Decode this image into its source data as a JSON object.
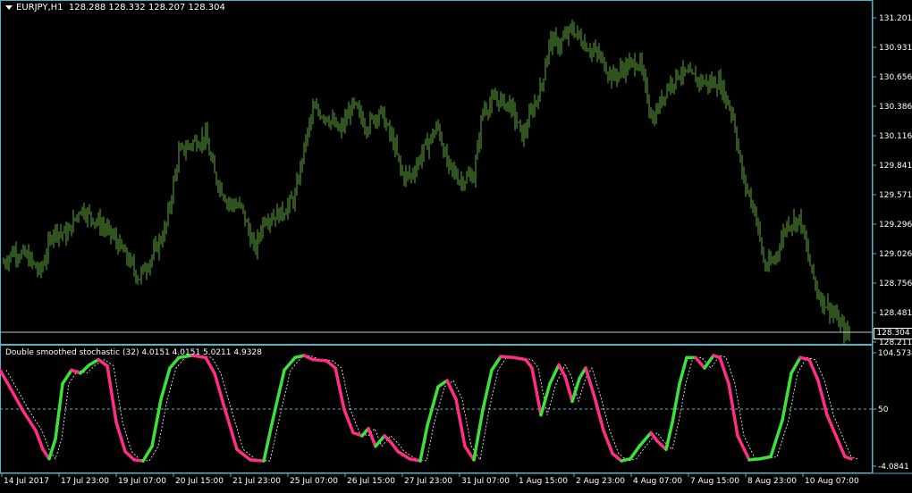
{
  "window": {
    "symbol_title": "EURJPY,H1",
    "ohlc": "128.288 128.332 128.207 128.304"
  },
  "indicator": {
    "title": "Double smoothed stochastic (32) 4.0151 4.0151 5.0211 4.9328"
  },
  "price_axis": {
    "labels": [
      "131.201",
      "130.931",
      "130.656",
      "130.386",
      "130.116",
      "129.841",
      "129.571",
      "129.296",
      "129.026",
      "128.756",
      "128.481",
      "128.211"
    ],
    "current_price": "128.304"
  },
  "indicator_axis": {
    "labels": [
      "104.5734",
      "50",
      "-4.0841"
    ],
    "levels": [
      0,
      50,
      100
    ]
  },
  "time_axis": {
    "labels": [
      "14 Jul 2017",
      "17 Jul 23:00",
      "19 Jul 07:00",
      "20 Jul 15:00",
      "21 Jul 23:00",
      "25 Jul 07:00",
      "26 Jul 15:00",
      "27 Jul 23:00",
      "31 Jul 07:00",
      "1 Aug 15:00",
      "2 Aug 23:00",
      "4 Aug 07:00",
      "7 Aug 15:00",
      "8 Aug 23:00",
      "10 Aug 07:00"
    ]
  },
  "colors": {
    "background": "#000000",
    "bars": "#5fa83c",
    "axis": "#4ab8c8",
    "stoch_up": "#3ee03a",
    "stoch_down": "#ff2d86",
    "signal": "#ffffff"
  },
  "chart_data": [
    {
      "type": "bar",
      "title": "EURJPY,H1",
      "ylim": [
        128.211,
        131.201
      ],
      "price_anchors": [
        [
          0,
          128.9
        ],
        [
          15,
          129.05
        ],
        [
          30,
          129.0
        ],
        [
          45,
          128.85
        ],
        [
          60,
          129.25
        ],
        [
          75,
          129.2
        ],
        [
          90,
          129.45
        ],
        [
          105,
          129.35
        ],
        [
          125,
          129.2
        ],
        [
          145,
          128.95
        ],
        [
          155,
          128.8
        ],
        [
          170,
          129.0
        ],
        [
          185,
          129.25
        ],
        [
          200,
          129.95
        ],
        [
          215,
          130.05
        ],
        [
          230,
          130.1
        ],
        [
          240,
          129.75
        ],
        [
          255,
          129.5
        ],
        [
          270,
          129.45
        ],
        [
          285,
          129.05
        ],
        [
          295,
          129.35
        ],
        [
          315,
          129.4
        ],
        [
          330,
          129.55
        ],
        [
          340,
          130.0
        ],
        [
          350,
          130.35
        ],
        [
          365,
          130.3
        ],
        [
          380,
          130.15
        ],
        [
          395,
          130.4
        ],
        [
          410,
          130.2
        ],
        [
          425,
          130.35
        ],
        [
          440,
          130.05
        ],
        [
          450,
          129.75
        ],
        [
          460,
          129.75
        ],
        [
          475,
          130.0
        ],
        [
          490,
          130.2
        ],
        [
          500,
          129.85
        ],
        [
          515,
          129.7
        ],
        [
          530,
          129.75
        ],
        [
          540,
          130.35
        ],
        [
          555,
          130.45
        ],
        [
          570,
          130.4
        ],
        [
          585,
          130.1
        ],
        [
          595,
          130.35
        ],
        [
          605,
          130.55
        ],
        [
          615,
          131.0
        ],
        [
          625,
          130.95
        ],
        [
          640,
          131.1
        ],
        [
          655,
          130.95
        ],
        [
          670,
          130.85
        ],
        [
          685,
          130.65
        ],
        [
          700,
          130.75
        ],
        [
          715,
          130.8
        ],
        [
          730,
          130.25
        ],
        [
          745,
          130.55
        ],
        [
          760,
          130.7
        ],
        [
          775,
          130.65
        ],
        [
          790,
          130.6
        ],
        [
          805,
          130.6
        ],
        [
          820,
          130.3
        ],
        [
          830,
          129.75
        ],
        [
          845,
          129.4
        ],
        [
          855,
          128.9
        ],
        [
          865,
          128.95
        ],
        [
          880,
          129.3
        ],
        [
          895,
          129.35
        ],
        [
          905,
          128.95
        ],
        [
          915,
          128.65
        ],
        [
          930,
          128.5
        ],
        [
          945,
          128.3
        ],
        [
          952,
          128.27
        ]
      ]
    },
    {
      "type": "line",
      "title": "Double smoothed stochastic (32)",
      "ylim": [
        -4.0841,
        104.5734
      ],
      "series": [
        {
          "name": "Double smoothed stochastic",
          "values": [
            [
              0,
              88
            ],
            [
              12,
              70
            ],
            [
              25,
              50
            ],
            [
              40,
              30
            ],
            [
              48,
              12
            ],
            [
              55,
              3
            ],
            [
              62,
              22
            ],
            [
              70,
              75
            ],
            [
              80,
              88
            ],
            [
              90,
              85
            ],
            [
              100,
              93
            ],
            [
              110,
              98
            ],
            [
              120,
              92
            ],
            [
              130,
              38
            ],
            [
              140,
              10
            ],
            [
              150,
              2
            ],
            [
              160,
              1
            ],
            [
              170,
              15
            ],
            [
              180,
              60
            ],
            [
              190,
              90
            ],
            [
              200,
              100
            ],
            [
              215,
              102
            ],
            [
              230,
              100
            ],
            [
              240,
              85
            ],
            [
              250,
              55
            ],
            [
              265,
              12
            ],
            [
              280,
              2
            ],
            [
              295,
              1
            ],
            [
              305,
              40
            ],
            [
              318,
              88
            ],
            [
              330,
              100
            ],
            [
              340,
              102
            ],
            [
              350,
              98
            ],
            [
              365,
              97
            ],
            [
              375,
              90
            ],
            [
              385,
              50
            ],
            [
              395,
              28
            ],
            [
              405,
              25
            ],
            [
              412,
              32
            ],
            [
              420,
              15
            ],
            [
              430,
              25
            ],
            [
              438,
              18
            ],
            [
              445,
              10
            ],
            [
              458,
              3
            ],
            [
              470,
              1
            ],
            [
              478,
              35
            ],
            [
              490,
              72
            ],
            [
              500,
              78
            ],
            [
              510,
              60
            ],
            [
              520,
              15
            ],
            [
              530,
              2
            ],
            [
              540,
              50
            ],
            [
              550,
              88
            ],
            [
              560,
              101
            ],
            [
              575,
              100
            ],
            [
              588,
              98
            ],
            [
              595,
              90
            ],
            [
              605,
              45
            ],
            [
              615,
              75
            ],
            [
              625,
              93
            ],
            [
              632,
              82
            ],
            [
              640,
              58
            ],
            [
              648,
              80
            ],
            [
              655,
              90
            ],
            [
              665,
              62
            ],
            [
              675,
              30
            ],
            [
              685,
              8
            ],
            [
              695,
              1
            ],
            [
              705,
              3
            ],
            [
              715,
              15
            ],
            [
              728,
              28
            ],
            [
              735,
              20
            ],
            [
              745,
              12
            ],
            [
              752,
              38
            ],
            [
              760,
              75
            ],
            [
              768,
              100
            ],
            [
              778,
              100
            ],
            [
              788,
              90
            ],
            [
              798,
              102
            ],
            [
              805,
              100
            ],
            [
              815,
              75
            ],
            [
              825,
              25
            ],
            [
              838,
              2
            ],
            [
              850,
              3
            ],
            [
              862,
              5
            ],
            [
              875,
              40
            ],
            [
              885,
              85
            ],
            [
              895,
              100
            ],
            [
              905,
              98
            ],
            [
              915,
              78
            ],
            [
              925,
              45
            ],
            [
              935,
              25
            ],
            [
              945,
              5
            ],
            [
              952,
              3
            ]
          ]
        }
      ]
    }
  ]
}
